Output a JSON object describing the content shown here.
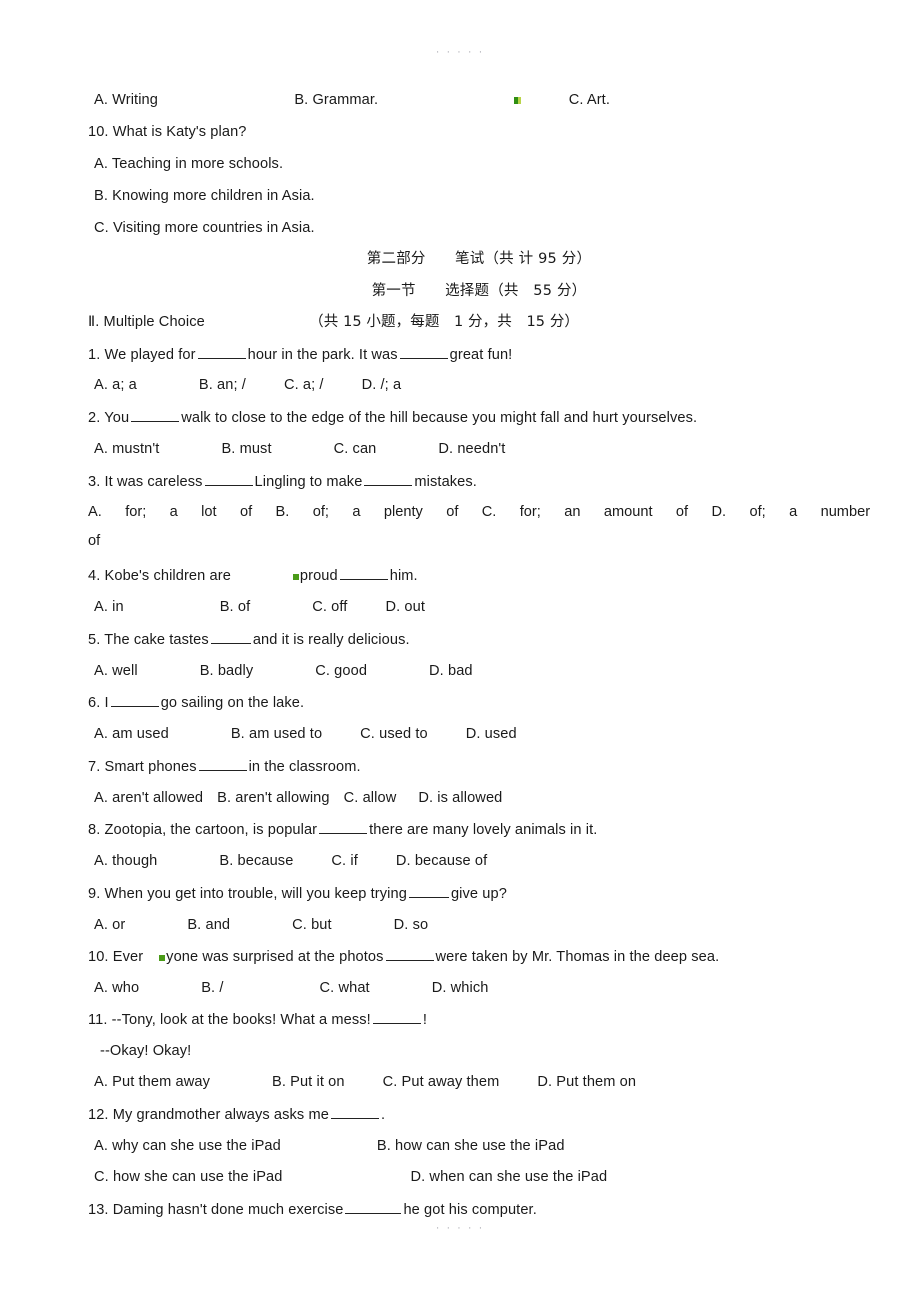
{
  "page": {
    "top_mark": "· · · · ·",
    "bottom_mark": "· · · · ·"
  },
  "listening_tail": {
    "q9_options": {
      "a": "A. Writing",
      "b": "B. Grammar.",
      "c": "C. Art."
    },
    "q10_stem": "10. What is Katy's plan?",
    "q10_options": [
      "A. Teaching in more schools.",
      "B. Knowing more children in Asia.",
      "C. Visiting more countries in Asia."
    ]
  },
  "headers": {
    "part_two": "第二部分　　笔试（共 计 95 分）",
    "section_one": "第一节　　选择题（共　55 分）"
  },
  "section": {
    "roman": "Ⅱ",
    "title": ". Multiple Choice",
    "score_note": "（共 15 小题，每题　1 分，共　15 分）"
  },
  "questions": [
    {
      "number": "1.",
      "stem_a": "We played for",
      "stem_b": "hour in the park. It was",
      "stem_c": "great fun!",
      "options": [
        "A. a; a",
        "B. an; /",
        "C. a; /",
        "D. /; a"
      ]
    },
    {
      "number": "2.",
      "stem_a": "You",
      "stem_b": "walk to close to the edge of the hill because you might fall and hurt yourselves.",
      "options": [
        "A. mustn't",
        "B. must",
        "C. can",
        "D. needn't"
      ]
    },
    {
      "number": "3.",
      "stem_a": "It was careless",
      "stem_b": "Lingling to make",
      "stem_c": "mistakes.",
      "options_justified": [
        "A.",
        "for;",
        "a lot",
        "of",
        "B.",
        "of;",
        "a plenty",
        "of",
        "C.",
        "for;",
        "an amount of",
        "D.",
        "of;",
        "a number"
      ],
      "options_tail": "of"
    },
    {
      "number": "4.",
      "stem_a": "Kobe's children are",
      "stem_b": "proud",
      "stem_c": "him.",
      "options": [
        "A. in",
        "B. of",
        "C. off",
        "D. out"
      ]
    },
    {
      "number": "5.",
      "stem_a": "The cake tastes",
      "stem_b": "and it is really delicious.",
      "options": [
        "A. well",
        "B. badly",
        "C. good",
        "D. bad"
      ]
    },
    {
      "number": "6.",
      "stem_a": "I",
      "stem_b": "go sailing on the lake.",
      "options": [
        "A. am used",
        "B. am used to",
        "C. used to",
        "D. used"
      ]
    },
    {
      "number": "7.",
      "stem_a": "Smart phones",
      "stem_b": "in the classroom.",
      "options": [
        "A. aren't allowed",
        "B. aren't allowing",
        "C. allow",
        "D. is allowed"
      ]
    },
    {
      "number": "8.",
      "stem_a": "Zootopia, the cartoon, is popular",
      "stem_b": "there are many lovely animals in it.",
      "options": [
        "A. though",
        "B. because",
        "C. if",
        "D. because of"
      ]
    },
    {
      "number": "9.",
      "stem_a": "When you get into trouble, will you keep trying",
      "stem_b": "give up?",
      "options": [
        "A. or",
        "B. and",
        "C. but",
        "D. so"
      ]
    },
    {
      "number": "10.",
      "stem_a": "Ever",
      "stem_b": "yone was surprised at the photos",
      "stem_c": "were taken by Mr. Thomas in the deep sea.",
      "options": [
        "A. who",
        "B. /",
        "C. what",
        "D. which"
      ]
    },
    {
      "number": "11.",
      "stem_a": "--Tony, look at the books! What a mess!",
      "stem_b": "!",
      "reply": "--Okay! Okay!",
      "options": [
        "A. Put them away",
        "B. Put it on",
        "C. Put away them",
        "D. Put them on"
      ]
    },
    {
      "number": "12.",
      "stem_a": "My grandmother always asks me",
      "stem_b": ".",
      "options": [
        "A. why can she use the iPad",
        "B. how can she use the iPad",
        "C. how she can use the iPad",
        "D. when can she use the iPad"
      ]
    },
    {
      "number": "13.",
      "stem_a": "Daming hasn't done much exercise",
      "stem_b": "he got his computer."
    }
  ]
}
